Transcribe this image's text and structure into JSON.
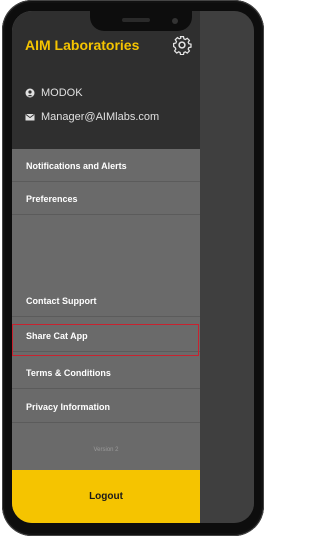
{
  "app": {
    "title": "AIM Laboratories"
  },
  "user": {
    "name": "MODOK",
    "email": "Manager@AIMlabs.com"
  },
  "menu": {
    "items": [
      {
        "label": "Notifications and Alerts"
      },
      {
        "label": "Preferences"
      },
      {
        "label": "Contact Support"
      },
      {
        "label": "Share Cat App",
        "highlighted": true
      },
      {
        "label": "Terms & Conditions"
      },
      {
        "label": "Privacy Information"
      }
    ]
  },
  "footer": {
    "version": "Version 2",
    "logout": "Logout"
  },
  "colors": {
    "brand": "#f5c400",
    "highlight_border": "#c8222f",
    "drawer_bg": "#6a6a6a",
    "header_bg": "#2f2f2f"
  },
  "icons": {
    "settings": "gear-icon",
    "user": "user-icon",
    "email": "mail-icon",
    "menu": "menu-icon"
  }
}
